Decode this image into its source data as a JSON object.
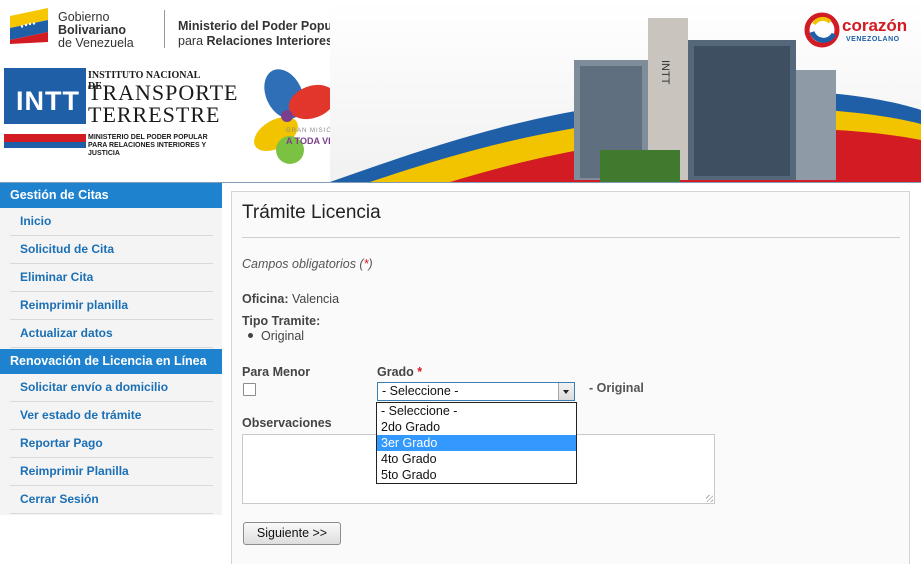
{
  "header": {
    "gobierno_line1": "Gobierno",
    "gobierno_line2": "Bolivariano",
    "gobierno_line3": "de Venezuela",
    "ministerio_line1": "Ministerio del Poder Popular",
    "ministerio_line2_prefix": "para ",
    "ministerio_line2_bold": "Relaciones Interiores y Justicia",
    "intt_mark": "INTT",
    "intt_line1": "INSTITUTO NACIONAL DE",
    "intt_line2": "TRANSPORTE",
    "intt_line3": "TERRESTRE",
    "intt_line4": "MINISTERIO DEL PODER POPULAR PARA RELACIONES INTERIORES Y JUSTICIA",
    "gm_line1": "GRAN MISIÓN",
    "gm_line2": "A TODA VIDA",
    "corazon_line1": "corazón",
    "corazon_line2": "VENEZOLANO",
    "building_sign": "INTT"
  },
  "sidebar": {
    "sections": [
      {
        "title": "Gestión de Citas",
        "items": [
          "Inicio",
          "Solicitud de Cita",
          "Eliminar Cita",
          "Reimprimir planilla",
          "Actualizar datos"
        ]
      },
      {
        "title": "Renovación de Licencia en Línea",
        "items": [
          "Solicitar envío a domicilio",
          "Ver estado de trámite",
          "Reportar Pago",
          "Reimprimir Planilla",
          "Cerrar Sesión"
        ]
      }
    ]
  },
  "form": {
    "title": "Trámite Licencia",
    "required_note": "Campos obligatorios (",
    "required_star": "*",
    "required_close": ")",
    "oficina_label": "Oficina:",
    "oficina_value": " Valencia",
    "tipo_label": "Tipo Tramite:",
    "tipo_value": "Original",
    "menor_label": "Para Menor",
    "grado_label": "Grado ",
    "grado_star": "*",
    "grado_selected": "- Seleccione -",
    "grado_suffix": "- Original",
    "grado_options": [
      "- Seleccione -",
      "2do Grado",
      "3er Grado",
      "4to Grado",
      "5to Grado"
    ],
    "grado_highlighted_index": 2,
    "observaciones_label": "Observaciones",
    "observaciones_value": "",
    "next_button": "Siguiente >>"
  },
  "colors": {
    "sidebar_section_bg": "#1e82cf",
    "sidebar_link": "#1a6fb5",
    "dropdown_highlight": "#3399ff",
    "required_star": "#d21b22"
  }
}
